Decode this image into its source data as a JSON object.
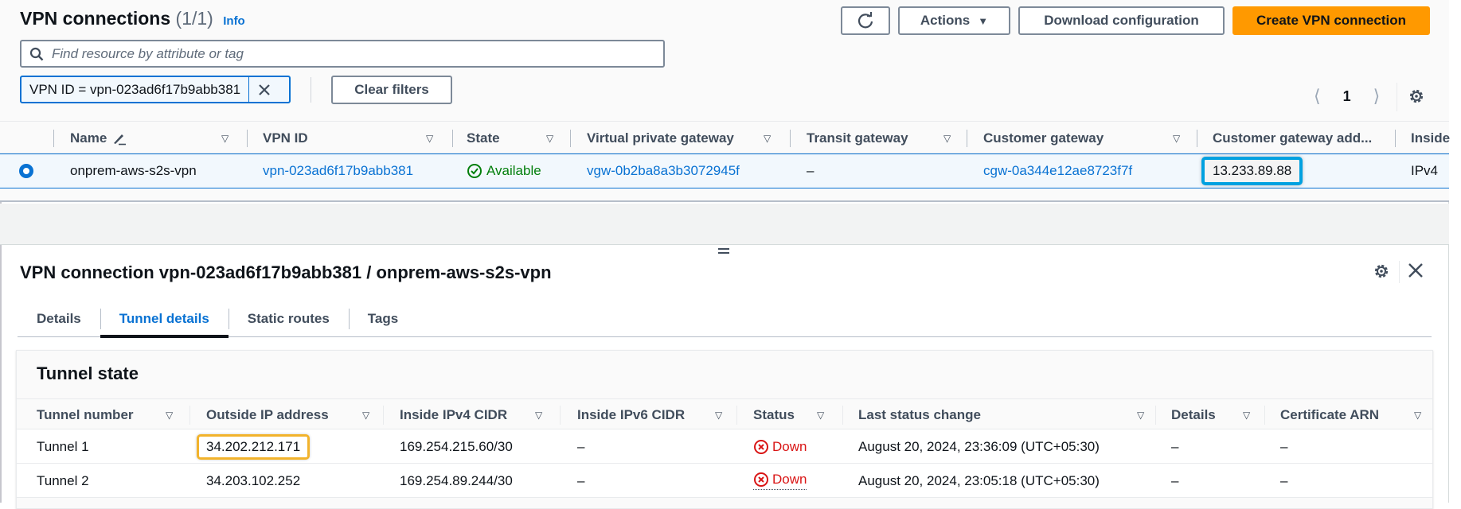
{
  "header": {
    "title": "VPN connections",
    "count": "(1/1)",
    "info": "Info"
  },
  "toolbar": {
    "refresh_icon": "refresh-icon",
    "actions_label": "Actions",
    "download_label": "Download configuration",
    "create_label": "Create VPN connection",
    "accent_color": "#ff9900"
  },
  "search": {
    "placeholder": "Find resource by attribute or tag",
    "value": ""
  },
  "filter": {
    "token": "VPN ID = vpn-023ad6f17b9abb381",
    "clear_label": "Clear filters"
  },
  "pagination": {
    "page": "1"
  },
  "connections_table": {
    "columns": [
      "Name",
      "VPN ID",
      "State",
      "Virtual private gateway",
      "Transit gateway",
      "Customer gateway",
      "Customer gateway add...",
      "Inside"
    ],
    "rows": [
      {
        "selected": true,
        "name": "onprem-aws-s2s-vpn",
        "vpn_id": "vpn-023ad6f17b9abb381",
        "state": "Available",
        "vgw": "vgw-0b2ba8a3b3072945f",
        "tgw": "–",
        "cgw": "cgw-0a344e12ae8723f7f",
        "cgw_address": "13.233.89.88",
        "inside": "IPv4"
      }
    ]
  },
  "detail": {
    "title": "VPN connection vpn-023ad6f17b9abb381 / onprem-aws-s2s-vpn",
    "tabs": [
      {
        "label": "Details",
        "active": false
      },
      {
        "label": "Tunnel details",
        "active": true
      },
      {
        "label": "Static routes",
        "active": false
      },
      {
        "label": "Tags",
        "active": false
      }
    ],
    "tunnel_state": {
      "title": "Tunnel state",
      "columns": [
        "Tunnel number",
        "Outside IP address",
        "Inside IPv4 CIDR",
        "Inside IPv6 CIDR",
        "Status",
        "Last status change",
        "Details",
        "Certificate ARN"
      ],
      "rows": [
        {
          "tunnel": "Tunnel 1",
          "outside_ip": "34.202.212.171",
          "inside_ipv4": "169.254.215.60/30",
          "inside_ipv6": "–",
          "status": "Down",
          "last_change": "August 20, 2024, 23:36:09 (UTC+05:30)",
          "details": "–",
          "cert_arn": "–"
        },
        {
          "tunnel": "Tunnel 2",
          "outside_ip": "34.203.102.252",
          "inside_ipv4": "169.254.89.244/30",
          "inside_ipv6": "–",
          "status": "Down",
          "last_change": "August 20, 2024, 23:05:18 (UTC+05:30)",
          "details": "–",
          "cert_arn": "–"
        }
      ]
    }
  }
}
